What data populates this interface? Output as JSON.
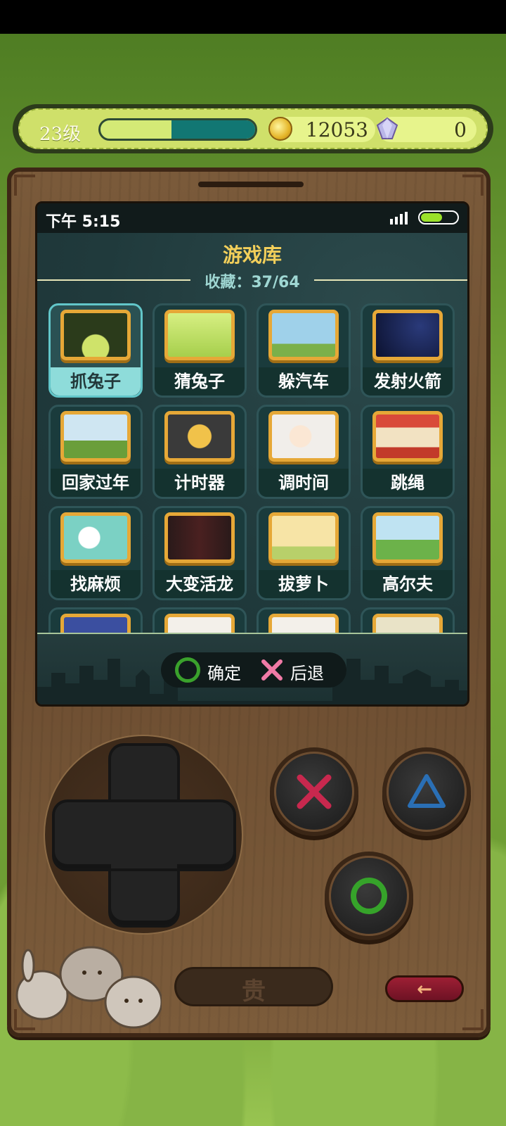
{
  "top_bar": {
    "level": "23级",
    "xp_progress": 0.46,
    "coins": "12053",
    "gems": "0"
  },
  "screen": {
    "status_time": "下午 5:15",
    "battery_level": 0.55,
    "title": "游戏库",
    "favorites": "收藏：37/64",
    "games": [
      {
        "label": "抓兔子",
        "selected": true
      },
      {
        "label": "猜兔子",
        "selected": false
      },
      {
        "label": "躲汽车",
        "selected": false
      },
      {
        "label": "发射火箭",
        "selected": false
      },
      {
        "label": "回家过年",
        "selected": false
      },
      {
        "label": "计时器",
        "selected": false
      },
      {
        "label": "调时间",
        "selected": false
      },
      {
        "label": "跳绳",
        "selected": false
      },
      {
        "label": "找麻烦",
        "selected": false
      },
      {
        "label": "大变活龙",
        "selected": false
      },
      {
        "label": "拔萝卜",
        "selected": false
      },
      {
        "label": "高尔夫",
        "selected": false
      }
    ],
    "hint": {
      "confirm": "确定",
      "back": "后退"
    }
  },
  "controls": {
    "select_glyph": "贵",
    "back_arrow": "←",
    "colors": {
      "cross": "#c8284e",
      "triangle": "#2a6fb5",
      "circle": "#36a32a"
    }
  }
}
